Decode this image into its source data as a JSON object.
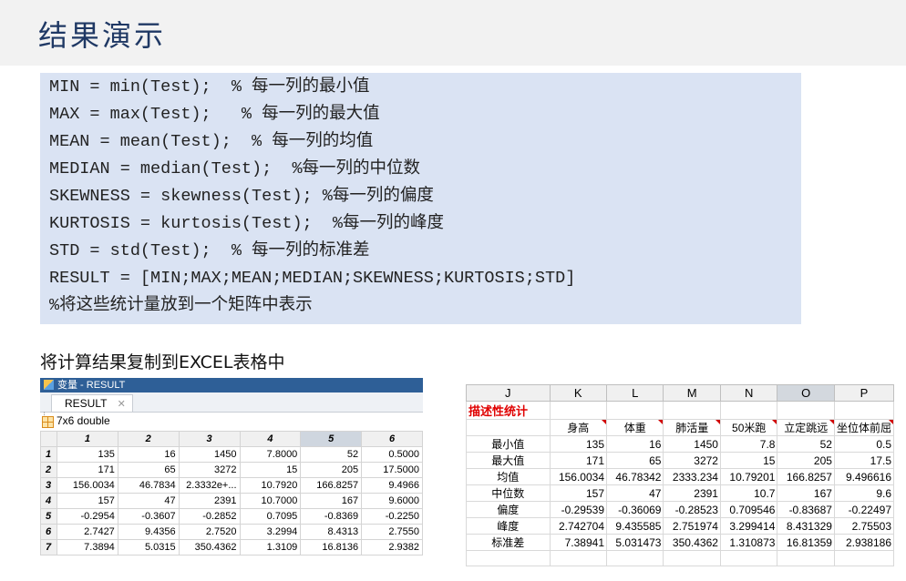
{
  "slide_title": "结果演示",
  "code_lines": [
    "MIN = min(Test);  % 每一列的最小值",
    "MAX = max(Test);   % 每一列的最大值",
    "MEAN = mean(Test);  % 每一列的均值",
    "MEDIAN = median(Test);  %每一列的中位数",
    "SKEWNESS = skewness(Test); %每一列的偏度",
    "KURTOSIS = kurtosis(Test);  %每一列的峰度",
    "STD = std(Test);  % 每一列的标准差",
    "RESULT = [MIN;MAX;MEAN;MEDIAN;SKEWNESS;KURTOSIS;STD]",
    "%将这些统计量放到一个矩阵中表示"
  ],
  "caption": "将计算结果复制到EXCEL表格中",
  "matlab": {
    "window_title": "变量 - RESULT",
    "tab_label": "RESULT",
    "tab_close": "✕",
    "size_info": "7x6 double",
    "col_headers": [
      "1",
      "2",
      "3",
      "4",
      "5",
      "6"
    ],
    "rows": [
      {
        "idx": "1",
        "cells": [
          "135",
          "16",
          "1450",
          "7.8000",
          "52",
          "0.5000"
        ]
      },
      {
        "idx": "2",
        "cells": [
          "171",
          "65",
          "3272",
          "15",
          "205",
          "17.5000"
        ]
      },
      {
        "idx": "3",
        "cells": [
          "156.0034",
          "46.7834",
          "2.3332e+...",
          "10.7920",
          "166.8257",
          "9.4966"
        ]
      },
      {
        "idx": "4",
        "cells": [
          "157",
          "47",
          "2391",
          "10.7000",
          "167",
          "9.6000"
        ]
      },
      {
        "idx": "5",
        "cells": [
          "-0.2954",
          "-0.3607",
          "-0.2852",
          "0.7095",
          "-0.8369",
          "-0.2250"
        ]
      },
      {
        "idx": "6",
        "cells": [
          "2.7427",
          "9.4356",
          "2.7520",
          "3.2994",
          "8.4313",
          "2.7550"
        ]
      },
      {
        "idx": "7",
        "cells": [
          "7.3894",
          "5.0315",
          "350.4362",
          "1.3109",
          "16.8136",
          "2.9382"
        ]
      }
    ]
  },
  "excel": {
    "col_headers": [
      "J",
      "K",
      "L",
      "M",
      "N",
      "O",
      "P"
    ],
    "section_title": "描述性统计",
    "field_headers": [
      "身高",
      "体重",
      "肺活量",
      "50米跑",
      "立定跳远",
      "坐位体前屈"
    ],
    "rows": [
      {
        "label": "最小值",
        "cells": [
          "135",
          "16",
          "1450",
          "7.8",
          "52",
          "0.5"
        ]
      },
      {
        "label": "最大值",
        "cells": [
          "171",
          "65",
          "3272",
          "15",
          "205",
          "17.5"
        ]
      },
      {
        "label": "均值",
        "cells": [
          "156.0034",
          "46.78342",
          "2333.234",
          "10.79201",
          "166.8257",
          "9.496616"
        ]
      },
      {
        "label": "中位数",
        "cells": [
          "157",
          "47",
          "2391",
          "10.7",
          "167",
          "9.6"
        ]
      },
      {
        "label": "偏度",
        "cells": [
          "-0.29539",
          "-0.36069",
          "-0.28523",
          "0.709546",
          "-0.83687",
          "-0.22497"
        ]
      },
      {
        "label": "峰度",
        "cells": [
          "2.742704",
          "9.435585",
          "2.751974",
          "3.299414",
          "8.431329",
          "2.75503"
        ]
      },
      {
        "label": "标准差",
        "cells": [
          "7.38941",
          "5.031473",
          "350.4362",
          "1.310873",
          "16.81359",
          "2.938186"
        ]
      }
    ]
  }
}
